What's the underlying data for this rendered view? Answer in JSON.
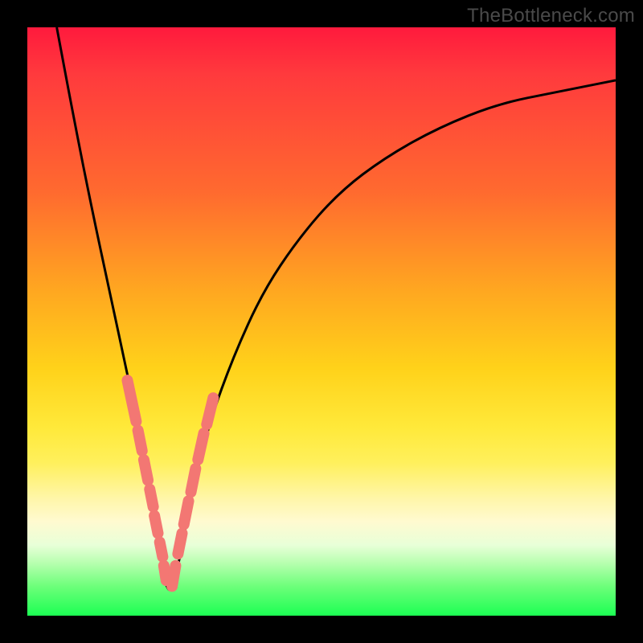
{
  "watermark": "TheBottleneck.com",
  "colors": {
    "curve": "#000000",
    "capsule": "#f37773",
    "gradient_top": "#ff1a3d",
    "gradient_bottom": "#1cff53",
    "frame": "#000000"
  },
  "chart_data": {
    "type": "line",
    "title": "",
    "xlabel": "",
    "ylabel": "",
    "xlim": [
      0,
      100
    ],
    "ylim": [
      0,
      100
    ],
    "grid": false,
    "legend": "none",
    "curve_note": "V-shaped bottleneck curve; minimum near x≈24; left branch steep from top-left, right branch rises more gently toward top-right.",
    "series": [
      {
        "name": "bottleneck-curve",
        "x": [
          5,
          8,
          11,
          14,
          17,
          20,
          22,
          24,
          26,
          28,
          31,
          35,
          40,
          46,
          53,
          61,
          70,
          80,
          90,
          100
        ],
        "y": [
          100,
          84,
          69,
          55,
          41,
          27,
          14,
          2,
          10,
          21,
          33,
          44,
          55,
          64,
          72,
          78,
          83,
          87,
          89,
          91
        ]
      }
    ],
    "annotations": {
      "highlighted_segments_note": "Pink rounded capsules overlaid on the curve near the valley, clustered on both branches roughly between y≈10 and y≈35.",
      "capsules": [
        {
          "x1": 17.0,
          "y1": 40.0,
          "x2": 18.5,
          "y2": 33.0
        },
        {
          "x1": 18.8,
          "y1": 31.5,
          "x2": 19.5,
          "y2": 28.0
        },
        {
          "x1": 19.8,
          "y1": 26.5,
          "x2": 20.5,
          "y2": 23.0
        },
        {
          "x1": 20.8,
          "y1": 21.5,
          "x2": 21.4,
          "y2": 18.5
        },
        {
          "x1": 21.6,
          "y1": 17.0,
          "x2": 22.2,
          "y2": 14.0
        },
        {
          "x1": 22.5,
          "y1": 12.5,
          "x2": 23.0,
          "y2": 10.0
        },
        {
          "x1": 23.2,
          "y1": 8.5,
          "x2": 23.6,
          "y2": 6.0
        },
        {
          "x1": 24.6,
          "y1": 5.0,
          "x2": 25.2,
          "y2": 8.5
        },
        {
          "x1": 25.6,
          "y1": 10.5,
          "x2": 26.3,
          "y2": 14.0
        },
        {
          "x1": 26.6,
          "y1": 15.5,
          "x2": 27.4,
          "y2": 19.5
        },
        {
          "x1": 27.8,
          "y1": 21.0,
          "x2": 28.6,
          "y2": 25.0
        },
        {
          "x1": 29.0,
          "y1": 26.5,
          "x2": 30.0,
          "y2": 31.0
        },
        {
          "x1": 30.5,
          "y1": 32.5,
          "x2": 31.6,
          "y2": 37.0
        }
      ]
    }
  }
}
